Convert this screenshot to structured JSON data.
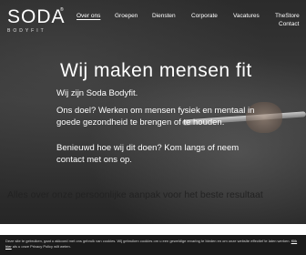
{
  "logo": {
    "name": "SODA",
    "registered": "®",
    "sub": "BODYFIT"
  },
  "nav": {
    "items": [
      {
        "label": "Over ons"
      },
      {
        "label": "Groepen"
      },
      {
        "label": "Diensten"
      },
      {
        "label": "Corporate"
      },
      {
        "label": "Vacatures"
      },
      {
        "label": "TheStore"
      },
      {
        "label": "Contact"
      }
    ]
  },
  "hero": {
    "title": "Wij maken mensen fit",
    "intro": "Wij zijn Soda Bodyfit.",
    "goal": "Ons doel? Werken om mensen fysiek en mentaal in goede gezondheid te brengen of te houden.",
    "cta": "Benieuwd hoe wij dit doen? Kom langs of neem contact met ons op."
  },
  "section": {
    "title": "Alles over onze persoonlijke aanpak voor het beste resultaat"
  },
  "cookie": {
    "text_before": "Deze site te gebruiken, gaat u akkoord met ons gebruik van cookies. Wij gebruiken cookies om u een geweldige ervaring te bieden en om onze website effectief te laten werken.",
    "link": "Klik hier",
    "text_after": "als u onze Privacy Policy wilt weten."
  }
}
